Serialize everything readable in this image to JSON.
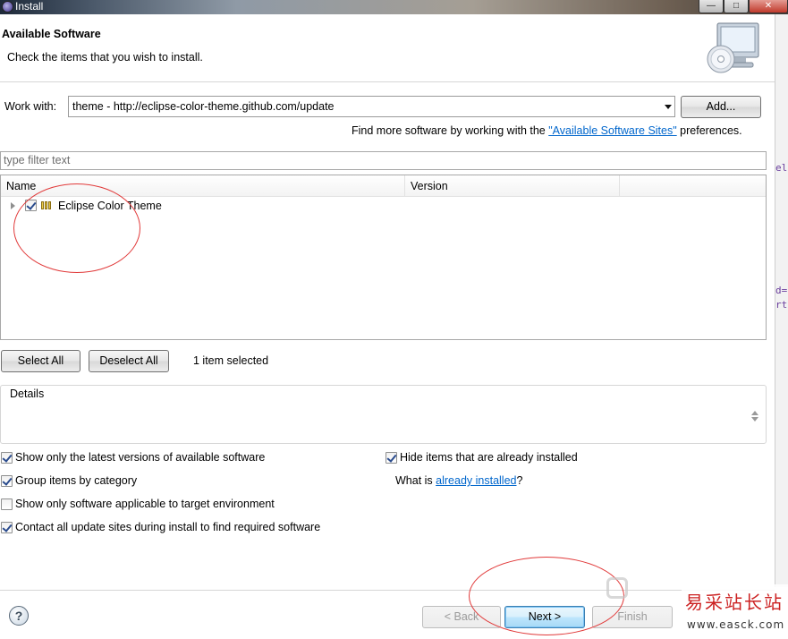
{
  "window": {
    "title": "Install",
    "controls": [
      "minimize",
      "maximize",
      "close"
    ]
  },
  "header": {
    "title": "Available Software",
    "subtitle": "Check the items that you wish to install.",
    "icon": "install-cd-icon"
  },
  "work_with": {
    "label": "Work with:",
    "value": "theme - http://eclipse-color-theme.github.com/update",
    "add_label": "Add...",
    "hint_before": "Find more software by working with the ",
    "hint_link": "\"Available Software Sites\"",
    "hint_after": " preferences."
  },
  "filter": {
    "placeholder": "type filter text"
  },
  "tree": {
    "columns": [
      "Name",
      "Version"
    ],
    "rows": [
      {
        "label": "Eclipse Color Theme",
        "version": "",
        "checked": true,
        "expanded": false
      }
    ]
  },
  "selection": {
    "select_all": "Select All",
    "deselect_all": "Deselect All",
    "status": "1 item selected"
  },
  "details": {
    "label": "Details"
  },
  "options": {
    "latest_only": {
      "label": "Show only the latest versions of available software",
      "checked": true
    },
    "group_by_category": {
      "label": "Group items by category",
      "checked": true
    },
    "target_env": {
      "label": "Show only software applicable to target environment",
      "checked": false
    },
    "contact_all": {
      "label": "Contact all update sites during install to find required software",
      "checked": true
    },
    "hide_installed": {
      "label": "Hide items that are already installed",
      "checked": true
    },
    "what_is_prefix": "What is ",
    "what_is_link": "already installed",
    "what_is_suffix": "?"
  },
  "footer": {
    "back": "< Back",
    "next": "Next >",
    "finish": "Finish",
    "help_icon": "help-icon"
  },
  "watermark": {
    "text": "易采站长站",
    "url": "www.easck.com"
  },
  "background_editor_fragments": [
    "elf",
    "d=\"",
    "rto"
  ]
}
